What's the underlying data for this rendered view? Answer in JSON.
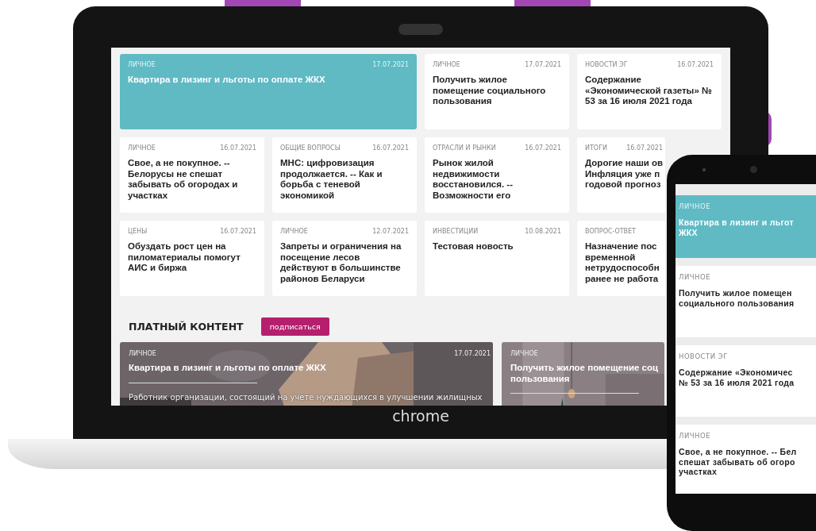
{
  "laptop": {
    "news": [
      {
        "category": "ЛИЧНОЕ",
        "date": "17.07.2021",
        "title": "Квартира в лизинг и льготы по оплате ЖКХ",
        "featured": true
      },
      {
        "category": "ЛИЧНОЕ",
        "date": "17.07.2021",
        "title": "Получить жилое помещение социального пользования",
        "featured": false
      },
      {
        "category": "НОВОСТИ ЭГ",
        "date": "16.07.2021",
        "title": "Содержание «Экономической газеты» № 53 за 16 июля 2021 года",
        "featured": false
      },
      {
        "category": "ЛИЧНОЕ",
        "date": "16.07.2021",
        "title": "Свое, а не покупное. -- Белорусы не спешат забывать об огородах и участках",
        "featured": false
      },
      {
        "category": "ОБЩИЕ ВОПРОСЫ",
        "date": "16.07.2021",
        "title": "МНС: цифровизация продолжается. -- Как и борьба с теневой экономикой",
        "featured": false
      },
      {
        "category": "ОТРАСЛИ И РЫНКИ",
        "date": "16.07.2021",
        "title": "Рынок жилой недвижимости восстановился. -- Возможности его",
        "featured": false
      },
      {
        "category": "ИТОГИ",
        "date": "16.07.2021",
        "title": "Дорогие наши ов\nИнфляция уже п\nгодовой прогноз",
        "featured": false
      },
      {
        "category": "ЦЕНЫ",
        "date": "16.07.2021",
        "title": "Обуздать рост цен на пиломатериалы помогут АИС и биржа",
        "featured": false
      },
      {
        "category": "ЛИЧНОЕ",
        "date": "12.07.2021",
        "title": "Запреты и ограничения на посещение лесов действуют в большинстве районов Беларуси",
        "featured": false
      },
      {
        "category": "ИНВЕСТИЦИИ",
        "date": "10.08.2021",
        "title": "Тестовая новость",
        "featured": false
      },
      {
        "category": "ВОПРОС-ОТВЕТ",
        "title": "Назначение пос\nвременной\nнетрудоспособн\nранее не работа",
        "featured": false
      }
    ],
    "paid_section": {
      "heading": "ПЛАТНЫЙ КОНТЕНТ",
      "button": "подписаться",
      "cards": [
        {
          "category": "ЛИЧНОЕ",
          "date": "17.07.2021",
          "title": "Квартира в лизинг и льготы по оплате ЖКХ",
          "excerpt": "Работник организации, состоящий на учете нуждающихся в улучшении жилищных"
        },
        {
          "category": "ЛИЧНОЕ",
          "title": "Получить жилое помещение соц\nпользования"
        }
      ]
    },
    "brand": "chrome"
  },
  "phone": {
    "news": [
      {
        "category": "ЛИЧНОЕ",
        "title": "Квартира в лизинг и льгот\nЖКХ",
        "featured": true
      },
      {
        "category": "ЛИЧНОЕ",
        "title": "Получить жилое помещен\nсоциального пользования",
        "featured": false
      },
      {
        "category": "НОВОСТИ ЭГ",
        "title": "Содержание «Экономичес\n№ 53 за 16 июля 2021 года",
        "featured": false
      },
      {
        "category": "ЛИЧНОЕ",
        "title": "Свое, а не покупное. -- Бел\nспешат забывать об огоро\nучастках",
        "featured": false
      }
    ]
  }
}
